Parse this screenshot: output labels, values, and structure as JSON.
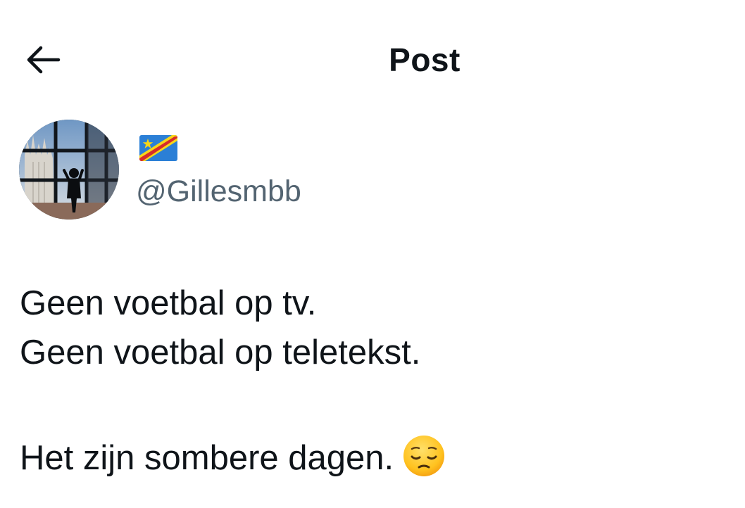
{
  "header": {
    "back_icon": "arrow-left-icon",
    "title": "Post"
  },
  "author": {
    "avatar_icon": "profile-photo",
    "display_name_icon": "flag-dr-congo-emoji",
    "handle": "@Gillesmbb"
  },
  "post": {
    "lines": [
      "Geen voetbal op tv.",
      "Geen voetbal op teletekst.",
      "",
      "Het zijn sombere dagen."
    ],
    "trailing_emoji": "pensive-face-emoji"
  },
  "colors": {
    "text_primary": "#0f1419",
    "text_secondary": "#536471",
    "background": "#ffffff"
  }
}
